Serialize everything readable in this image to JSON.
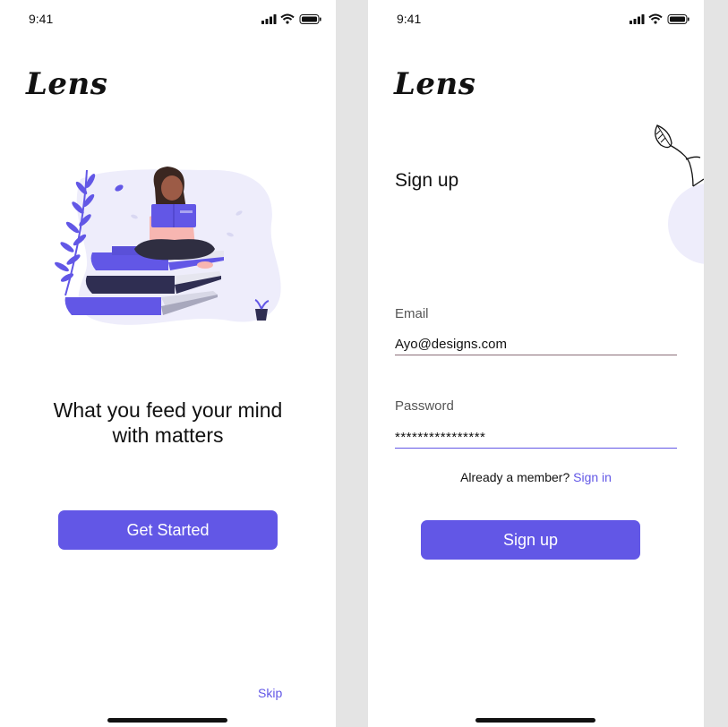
{
  "colors": {
    "accent": "#6257e6",
    "text": "#111111",
    "background": "#e4e4e4",
    "screen": "#ffffff"
  },
  "onboarding": {
    "status_time": "9:41",
    "logo": "Lens",
    "illustration": "woman-reading-on-books-illustration",
    "tagline_line1": "What you feed your mind",
    "tagline_line2": "with matters",
    "cta_label": "Get Started",
    "skip_label": "Skip"
  },
  "signup": {
    "status_time": "9:41",
    "logo": "Lens",
    "title": "Sign up",
    "email_label": "Email",
    "email_value": "Ayo@designs.com",
    "password_label": "Password",
    "password_value": "****************",
    "signin_prompt": "Already a member?",
    "signin_link": "Sign in",
    "submit_label": "Sign up"
  }
}
